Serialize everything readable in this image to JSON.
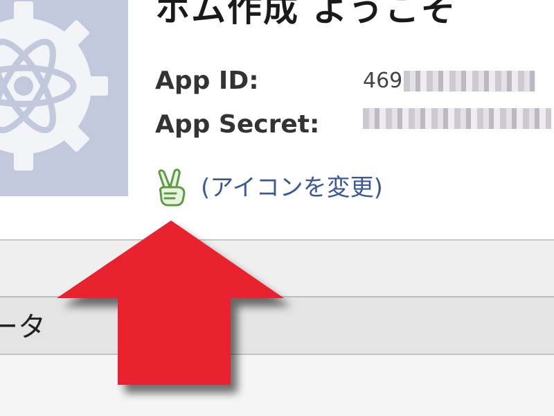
{
  "app": {
    "title": "ホム作成 ようこそ",
    "app_id_label": "App ID:",
    "app_id_value": "469",
    "app_secret_label": "App Secret:",
    "change_icon_link": "(アイコンを変更)"
  },
  "section": {
    "tab_label": "ータ"
  },
  "annotation": {
    "arrow_color": "#e8232f"
  },
  "icons": {
    "app_icon": "atom-gear-icon",
    "change_icon": "peace-hand-icon",
    "annotation": "red-up-arrow"
  }
}
